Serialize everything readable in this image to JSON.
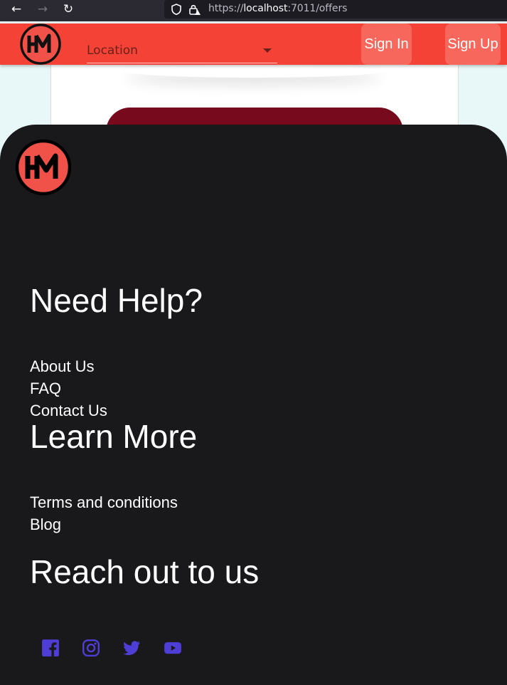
{
  "browser": {
    "url_prefix": "https://",
    "url_host": "localhost",
    "url_rest": ":7011/offers",
    "back_glyph": "←",
    "forward_glyph": "→",
    "reload_glyph": "↻",
    "icons": [
      "shield-icon",
      "lock-warning-icon"
    ]
  },
  "header": {
    "logo_alt": "HM",
    "location_placeholder": "Location",
    "signin_label": "Sign In",
    "signup_label": "Sign Up"
  },
  "footer": {
    "logo_alt": "HM",
    "help_heading": "Need Help?",
    "help_links": [
      "About Us",
      "FAQ",
      "Contact Us"
    ],
    "learn_heading": "Learn More",
    "learn_links": [
      "Terms and conditions",
      "Blog"
    ],
    "reach_heading": "Reach out to us",
    "social_icons": [
      "facebook-icon",
      "instagram-icon",
      "twitter-icon",
      "youtube-icon"
    ]
  },
  "colors": {
    "header_bg": "#f44336",
    "header_button_bg": "#f8675b",
    "footer_bg": "#19191c",
    "logo_fill": "#f0524a",
    "social_icon": "#4f3ed6",
    "offer_block": "#770b1d"
  }
}
